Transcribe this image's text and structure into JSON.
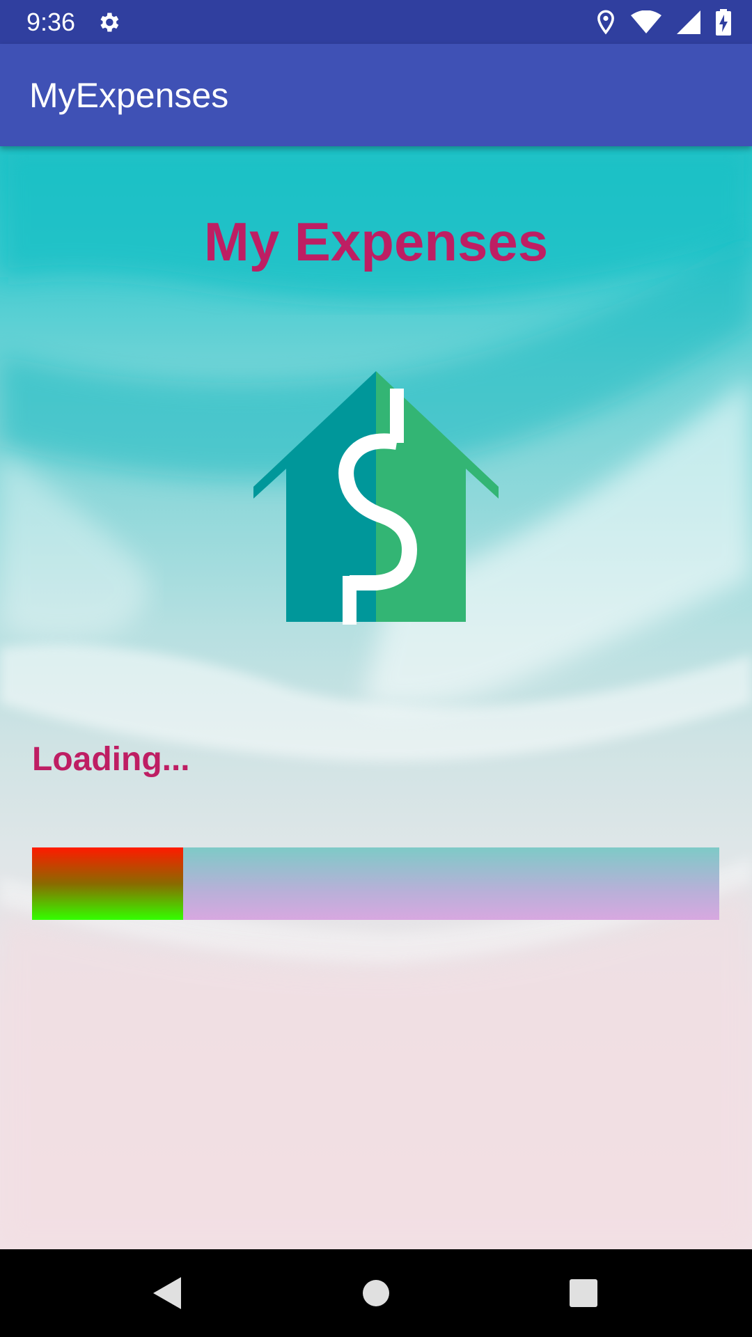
{
  "status_bar": {
    "time": "9:36",
    "icons": [
      "gear-icon",
      "location-icon",
      "wifi-icon",
      "signal-icon",
      "battery-charging-icon"
    ]
  },
  "app_bar": {
    "title": "MyExpenses"
  },
  "main": {
    "title": "My Expenses",
    "logo": "house-dollar-logo",
    "loading_text": "Loading...",
    "progress_fraction": 0.22
  },
  "nav_bar": {
    "icons": [
      "back-icon",
      "home-icon",
      "recents-icon"
    ]
  },
  "colors": {
    "status_bar": "#303F9F",
    "app_bar": "#3F51B5",
    "accent_text": "#BE1E63",
    "logo_dark": "#00979A",
    "logo_light": "#33B574"
  }
}
